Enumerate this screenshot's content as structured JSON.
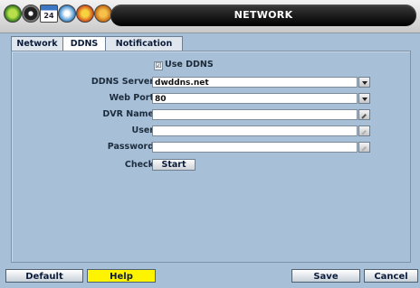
{
  "header": {
    "title": "NETWORK",
    "icons": [
      "system-icon",
      "record-icon",
      "calendar-icon",
      "network-icon",
      "event-icon",
      "disk-icon"
    ],
    "calendar_day": "24"
  },
  "tabs": [
    {
      "label": "Network",
      "active": false
    },
    {
      "label": "DDNS",
      "active": true
    },
    {
      "label": "Notification",
      "active": false
    }
  ],
  "form": {
    "use_ddns": {
      "label": "Use DDNS",
      "checked": true,
      "mark": "☑"
    },
    "ddns_server": {
      "label": "DDNS Server",
      "value": "dwddns.net"
    },
    "web_port": {
      "label": "Web Port",
      "value": "80"
    },
    "dvr_name": {
      "label": "DVR Name",
      "value": ""
    },
    "user": {
      "label": "User",
      "value": ""
    },
    "password": {
      "label": "Password",
      "value": ""
    },
    "check": {
      "label": "Check",
      "button": "Start"
    }
  },
  "footer": {
    "default": "Default",
    "help": "Help",
    "save": "Save",
    "cancel": "Cancel"
  },
  "colors": {
    "background": "#a7c0d8",
    "title_bar": "#000000",
    "help_button": "#fff400"
  }
}
